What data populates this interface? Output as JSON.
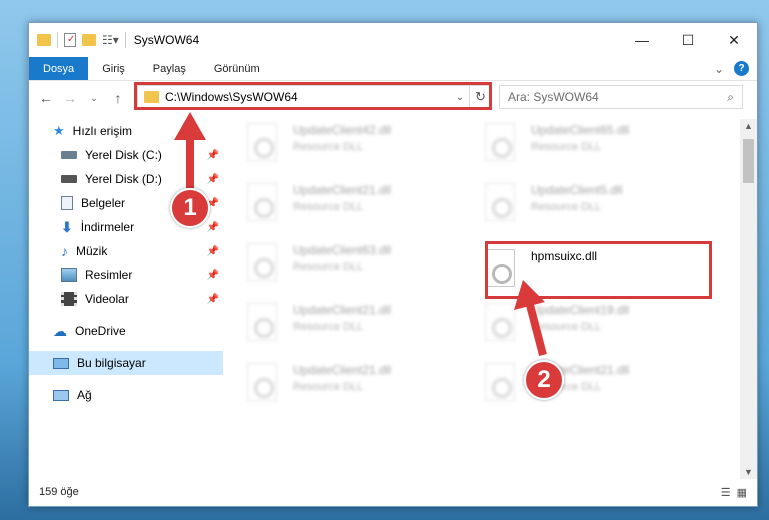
{
  "window": {
    "title": "SysWOW64"
  },
  "window_controls": {
    "minimize": "—",
    "maximize": "☐",
    "close": "✕"
  },
  "ribbon": {
    "tabs": [
      "Dosya",
      "Giriş",
      "Paylaş",
      "Görünüm"
    ],
    "help": "?",
    "expand": "⌄"
  },
  "address": {
    "path": "C:\\Windows\\SysWOW64",
    "dropdown": "⌄",
    "refresh": "↻"
  },
  "search": {
    "placeholder": "Ara: SysWOW64"
  },
  "sidebar": {
    "quick_access": "Hızlı erişim",
    "items": [
      "Yerel Disk (C:)",
      "Yerel Disk (D:)",
      "Belgeler",
      "İndirmeler",
      "Müzik",
      "Resimler",
      "Videolar"
    ],
    "onedrive": "OneDrive",
    "this_pc": "Bu bilgisayar",
    "network": "Ağ"
  },
  "files": [
    {
      "name": "UpdateClient42.dll",
      "desc": "Resource DLL"
    },
    {
      "name": "UpdateClient65.dll",
      "desc": "Resource DLL"
    },
    {
      "name": "UpdateClient21.dll",
      "desc": "Resource DLL"
    },
    {
      "name": "UpdateClient5.dll",
      "desc": "Resource DLL"
    },
    {
      "name": "UpdateClient63.dll",
      "desc": "Resource DLL"
    },
    {
      "name": "hpmsuixc.dll",
      "desc": ""
    },
    {
      "name": "UpdateClient21.dll",
      "desc": "Resource DLL"
    },
    {
      "name": "UpdateClient19.dll",
      "desc": "Resource DLL"
    },
    {
      "name": "UpdateClient21.dll",
      "desc": "Resource DLL"
    },
    {
      "name": "UpdateClient21.dll",
      "desc": "Resource DLL"
    }
  ],
  "status": {
    "count": "159 öğe"
  },
  "markers": {
    "one": "1",
    "two": "2"
  },
  "colors": {
    "accent": "#1979ca",
    "highlight": "#d63b3b"
  }
}
